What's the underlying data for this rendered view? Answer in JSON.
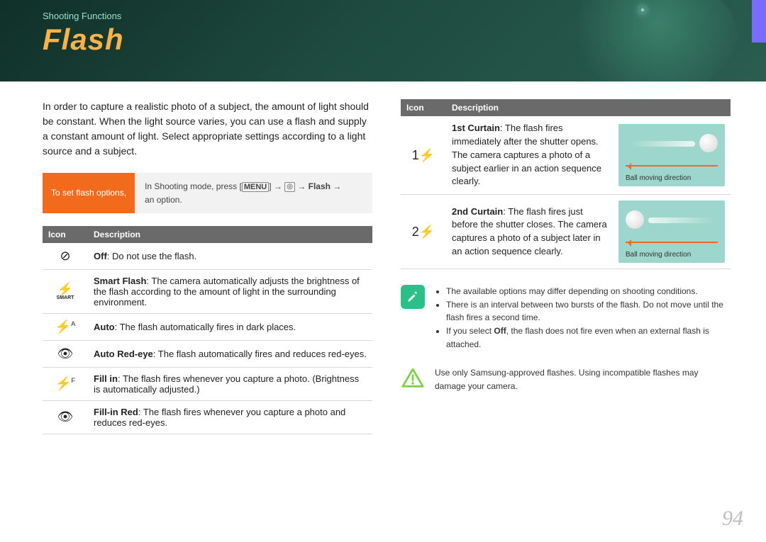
{
  "header": {
    "breadcrumb": "Shooting Functions",
    "title": "Flash"
  },
  "intro": "In order to capture a realistic photo of a subject, the amount of light should be constant. When the light source varies, you can use a flash and supply a constant amount of light. Select appropriate settings according to a light source and a subject.",
  "optbox": {
    "label": "To set flash options,",
    "line_pre": "In Shooting mode, press [",
    "menu": "MENU",
    "line_mid1": "] → ",
    "cam_icon": "◎",
    "line_mid2": " → ",
    "flash_word": "Flash",
    "line_mid3": " → ",
    "line_post": "an option."
  },
  "table": {
    "head_icon": "Icon",
    "head_desc": "Description",
    "rows": [
      {
        "icon": "⊘",
        "bold": "Off",
        "text": ": Do not use the flash."
      },
      {
        "icon": "⚡",
        "sub": "SMART",
        "bold": "Smart Flash",
        "text": ": The camera automatically adjusts the brightness of the flash according to the amount of light in the surrounding environment."
      },
      {
        "icon": "⚡",
        "sup": "A",
        "bold": "Auto",
        "text": ": The flash automatically fires in dark places."
      },
      {
        "icon": "👁",
        "bold": "Auto Red-eye",
        "text": ": The flash automatically fires and reduces red-eyes."
      },
      {
        "icon": "⚡",
        "sup": "F",
        "bold": "Fill in",
        "text": ": The flash fires whenever you capture a photo. (Brightness is automatically adjusted.)"
      },
      {
        "icon": "👁",
        "bold": "Fill-in Red",
        "text": ": The flash fires whenever you capture a photo and reduces red-eyes."
      }
    ]
  },
  "curtain": {
    "head_icon": "Icon",
    "head_desc": "Description",
    "rows": [
      {
        "icon": "1⚡",
        "bold": "1st Curtain",
        "text": ": The flash fires immediately after the shutter opens. The camera captures a photo of a subject earlier in an action sequence clearly.",
        "caption": "Ball moving direction"
      },
      {
        "icon": "2⚡",
        "bold": "2nd Curtain",
        "text": ": The flash fires just before the shutter closes. The camera captures a photo of a subject later in an action sequence clearly.",
        "caption": "Ball moving direction"
      }
    ]
  },
  "notes": {
    "bullets": [
      "The available options may differ depending on shooting conditions.",
      "There is an interval between two bursts of the flash. Do not move until the flash fires a second time.",
      "If you select Off, the flash does not fire even when an external flash is attached."
    ],
    "off_word": "Off",
    "warn": "Use only Samsung-approved flashes. Using incompatible flashes may damage your camera."
  },
  "page_number": "94"
}
